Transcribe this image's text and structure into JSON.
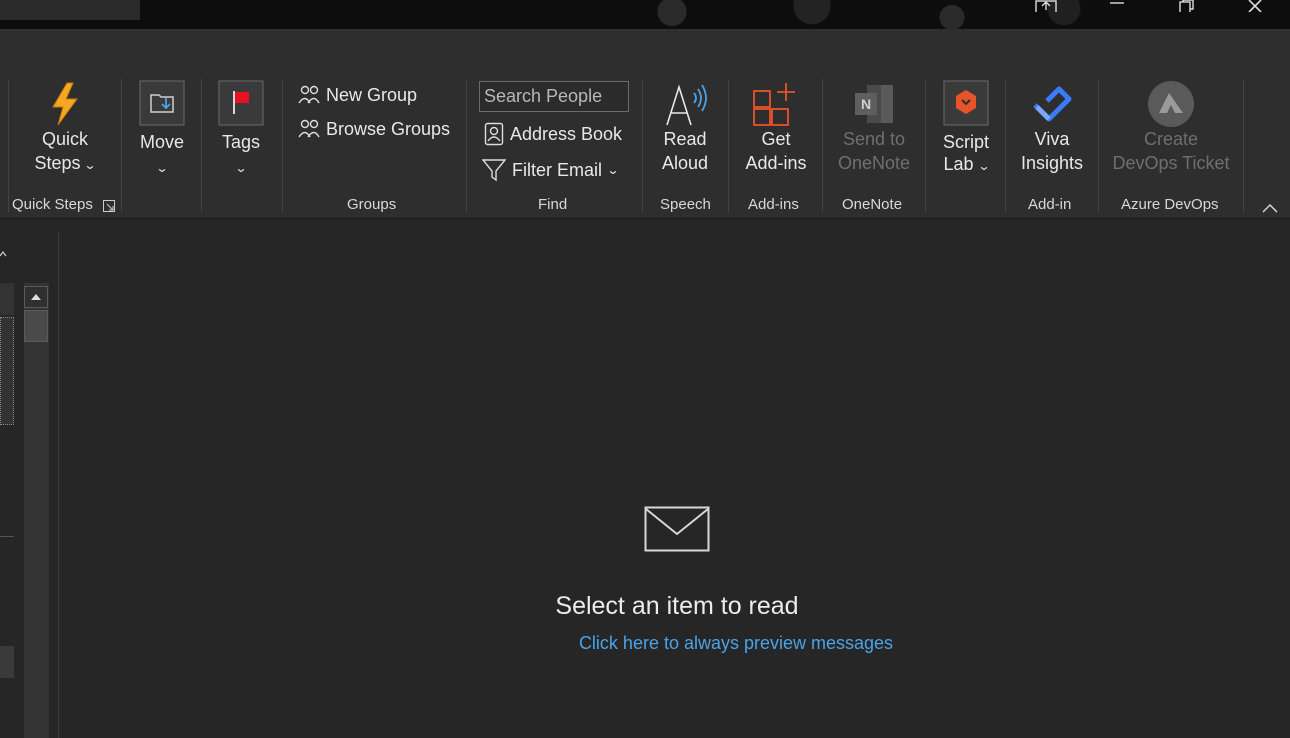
{
  "ribbon": {
    "quick_steps": {
      "label_line1": "Quick",
      "label_line2": "Steps",
      "group_label": "Quick Steps"
    },
    "move": {
      "label": "Move"
    },
    "tags": {
      "label": "Tags"
    },
    "groups": {
      "new_group": "New Group",
      "browse_groups": "Browse Groups",
      "group_label": "Groups"
    },
    "find": {
      "search_placeholder": "Search People",
      "address_book": "Address Book",
      "filter_email": "Filter Email",
      "group_label": "Find"
    },
    "speech": {
      "label_line1": "Read",
      "label_line2": "Aloud",
      "group_label": "Speech"
    },
    "addins": {
      "label_line1": "Get",
      "label_line2": "Add-ins",
      "group_label": "Add-ins"
    },
    "onenote": {
      "label_line1": "Send to",
      "label_line2": "OneNote",
      "group_label": "OneNote"
    },
    "scriptlab": {
      "label_line1": "Script",
      "label_line2": "Lab"
    },
    "viva": {
      "label_line1": "Viva",
      "label_line2": "Insights",
      "group_label": "Add-in"
    },
    "devops": {
      "label_line1": "Create",
      "label_line2": "DevOps Ticket",
      "group_label": "Azure DevOps"
    }
  },
  "reading_pane": {
    "empty_message": "Select an item to read",
    "preview_link": "Click here to always preview messages"
  },
  "colors": {
    "accent_link": "#4aa3e8",
    "flag_red": "#e81123",
    "addins_orange": "#e8542a",
    "viva_blue": "#3a7bff"
  },
  "icons": [
    "lightning-icon",
    "move-folder-icon",
    "flag-icon",
    "people-icon",
    "address-book-icon",
    "filter-icon",
    "read-aloud-icon",
    "addins-icon",
    "onenote-icon",
    "script-lab-icon",
    "viva-icon",
    "devops-icon",
    "envelope-icon"
  ]
}
